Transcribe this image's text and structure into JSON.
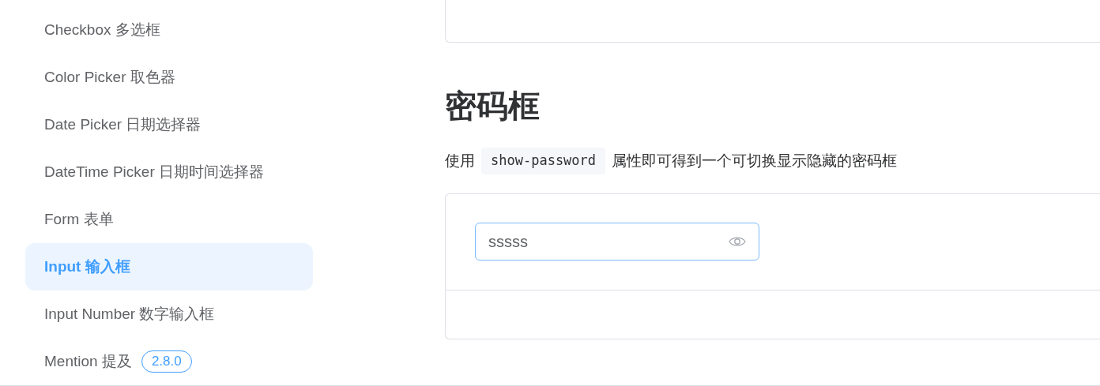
{
  "sidebar": {
    "items": [
      {
        "label": "Checkbox 多选框",
        "selected": false
      },
      {
        "label": "Color Picker 取色器",
        "selected": false
      },
      {
        "label": "Date Picker 日期选择器",
        "selected": false
      },
      {
        "label": "DateTime Picker 日期时间选择器",
        "selected": false
      },
      {
        "label": "Form 表单",
        "selected": false
      },
      {
        "label": "Input 输入框",
        "selected": true
      },
      {
        "label": "Input Number 数字输入框",
        "selected": false
      },
      {
        "label": "Mention 提及",
        "selected": false,
        "badge": "2.8.0"
      }
    ]
  },
  "section": {
    "title": "密码框",
    "description": [
      {
        "kind": "text",
        "text": "使用"
      },
      {
        "kind": "code",
        "text": "show-password"
      },
      {
        "kind": "text",
        "text": "属性即可得到一个可切换显示隐藏的密码框"
      }
    ],
    "demo": {
      "input": {
        "value": "sssss",
        "focused": true
      }
    }
  }
}
